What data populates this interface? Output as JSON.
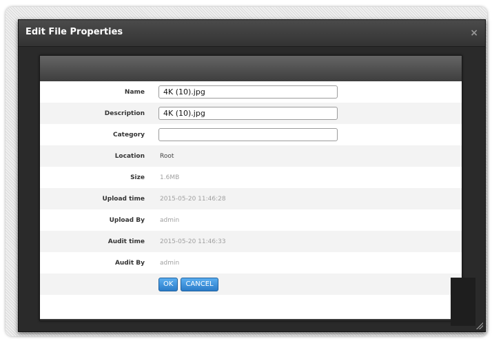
{
  "dialog": {
    "title": "Edit File Properties",
    "close_glyph": "×"
  },
  "form": {
    "name": {
      "label": "Name",
      "value": "4K (10).jpg"
    },
    "description": {
      "label": "Description",
      "value": "4K (10).jpg"
    },
    "category": {
      "label": "Category",
      "value": ""
    },
    "location": {
      "label": "Location",
      "value": "Root"
    },
    "size": {
      "label": "Size",
      "value": "1.6MB"
    },
    "upload_time": {
      "label": "Upload time",
      "value": "2015-05-20 11:46:28"
    },
    "upload_by": {
      "label": "Upload By",
      "value": "admin"
    },
    "audit_time": {
      "label": "Audit time",
      "value": "2015-05-20 11:46:33"
    },
    "audit_by": {
      "label": "Audit By",
      "value": "admin"
    }
  },
  "buttons": {
    "ok": "OK",
    "cancel": "CANCEL"
  },
  "icons": {
    "close": "close-icon",
    "resize": "resize-grip-icon"
  },
  "colors": {
    "button_accent": "#2b7cc9",
    "titlebar": "#3a3a3a"
  }
}
